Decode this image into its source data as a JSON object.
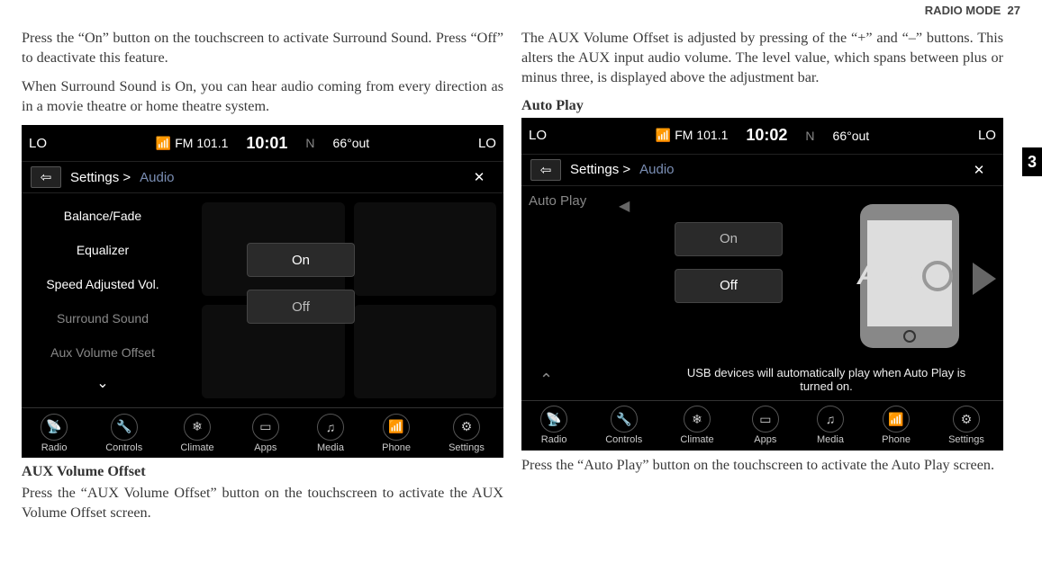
{
  "header": {
    "section": "RADIO MODE",
    "page": "27",
    "tab": "3"
  },
  "left": {
    "p1": "Press the “On” button on the touchscreen to activate Surround Sound. Press “Off” to deactivate this feature.",
    "p2": "When Surround Sound is On, you can hear audio coming from every direction as in a movie theatre or home theatre system.",
    "sub_head": "AUX Volume Offset",
    "p3": "Press the “AUX Volume Offset” button on the touchscreen to activate the AUX Volume Offset screen."
  },
  "right": {
    "p1": "The AUX Volume Offset is adjusted by pressing of the “+” and “–” buttons. This alters the AUX input audio volume. The level value, which spans between plus or minus three, is displayed above the adjustment bar.",
    "head": "Auto Play",
    "p2": "Press the “Auto Play” button on the touchscreen to activate the Auto Play screen."
  },
  "screen1": {
    "lo": "LO",
    "station": "FM 101.1",
    "time": "10:01",
    "nav_n": "N",
    "temp": "66°out",
    "crumb_settings": "Settings >",
    "crumb_audio": "Audio",
    "menu": {
      "balance": "Balance/Fade",
      "eq": "Equalizer",
      "speed": "Speed Adjusted Vol.",
      "surround": "Surround Sound",
      "aux": "Aux Volume Offset"
    },
    "on": "On",
    "off": "Off"
  },
  "screen2": {
    "lo": "LO",
    "station": "FM 101.1",
    "time": "10:02",
    "nav_n": "N",
    "temp": "66°out",
    "crumb_settings": "Settings >",
    "crumb_audio": "Audio",
    "auto_play": "Auto Play",
    "on": "On",
    "off": "Off",
    "auto_word": "AUT",
    "hint": "USB devices will automatically play when Auto Play is turned on."
  },
  "nav": {
    "radio": "Radio",
    "controls": "Controls",
    "climate": "Climate",
    "apps": "Apps",
    "media": "Media",
    "phone": "Phone",
    "settings": "Settings"
  }
}
